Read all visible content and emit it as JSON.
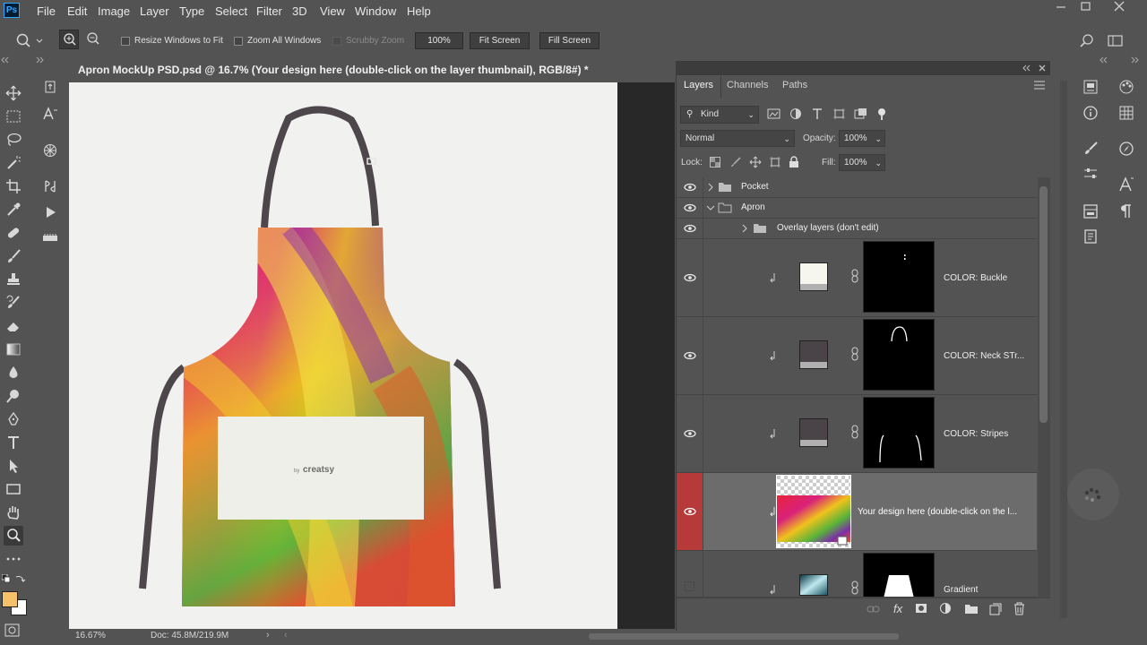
{
  "app": {
    "logo": "Ps"
  },
  "menu": [
    "File",
    "Edit",
    "Image",
    "Layer",
    "Type",
    "Select",
    "Filter",
    "3D",
    "View",
    "Window",
    "Help"
  ],
  "options": {
    "resize_windows": "Resize Windows to Fit",
    "zoom_all": "Zoom All Windows",
    "scrubby": "Scrubby Zoom",
    "zoom_value": "100%",
    "fit_screen": "Fit Screen",
    "fill_screen": "Fill Screen"
  },
  "document": {
    "tab_title": "Apron MockUp PSD.psd @ 16.7% (Your design here (double-click on the layer thumbnail), RGB/8#) *",
    "close": "×",
    "logo_text": "creatsy",
    "logo_prefix": "by"
  },
  "status": {
    "zoom": "16.67%",
    "doc": "Doc: 45.8M/219.9M"
  },
  "panel": {
    "tabs": [
      "Layers",
      "Channels",
      "Paths"
    ],
    "filter_kind": "Kind",
    "blend_mode": "Normal",
    "opacity_label": "Opacity:",
    "opacity_value": "100%",
    "lock_label": "Lock:",
    "fill_label": "Fill:",
    "fill_value": "100%",
    "layers": [
      {
        "name": "Pocket",
        "type": "group",
        "visible": true
      },
      {
        "name": "Apron",
        "type": "group",
        "visible": true,
        "expanded": true
      },
      {
        "name": "Overlay layers (don't edit)",
        "type": "group",
        "visible": true
      },
      {
        "name": "COLOR: Buckle",
        "type": "fill",
        "visible": true,
        "swatch": "#f6f6ef"
      },
      {
        "name": "COLOR: Neck STr...",
        "type": "fill",
        "visible": true,
        "swatch": "#4a4449"
      },
      {
        "name": "COLOR: Stripes",
        "type": "fill",
        "visible": true,
        "swatch": "#4a4449"
      },
      {
        "name": "Your design here (double-click on the l...",
        "type": "smart-object",
        "visible": true,
        "selected": true
      },
      {
        "name": "Gradient",
        "type": "gradient",
        "visible": false
      }
    ]
  },
  "colors": {
    "foreground": "#f5c26b",
    "background": "#ffffff",
    "selected_eye": "#b63a3a",
    "accent": "#31a8ff"
  }
}
